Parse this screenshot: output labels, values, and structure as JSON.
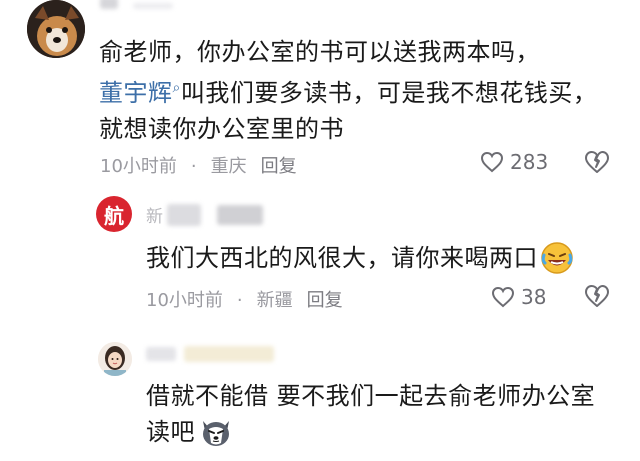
{
  "comment1": {
    "name": "",
    "text_line1": "俞老师，你办公室的书可以送我两本吗，",
    "mention": "董宇辉",
    "text_line2_rest": "叫我们要多读书，可是我不想花钱买，",
    "text_line3": "就想读你办公室里的书",
    "time": "10小时前",
    "location": "重庆",
    "reply": "回复",
    "likes": "283"
  },
  "reply1": {
    "avatar_char": "航",
    "name": "新",
    "text": "我们大西北的风很大，请你来喝两口",
    "emoji": "laughing-crying-emoji",
    "time": "10小时前",
    "location": "新疆",
    "reply": "回复",
    "likes": "38"
  },
  "reply2": {
    "name": "",
    "text_line1": "借就不能借  要不我们一起去俞老师办公室",
    "text_line2": "读吧",
    "emoji": "husky-dog-emoji"
  },
  "colors": {
    "mention": "#3d6fa8",
    "meta": "#9a9aa0",
    "badge": "#d9252f"
  }
}
